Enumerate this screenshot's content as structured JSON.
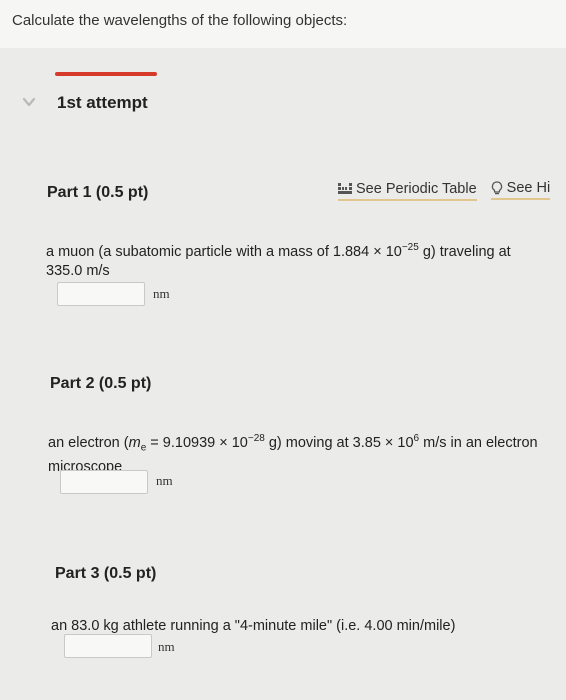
{
  "header": {
    "instruction": "Calculate the wavelengths of the following objects:"
  },
  "attempt": {
    "label": "1st attempt"
  },
  "tools": {
    "periodic_table": "See Periodic Table",
    "hint": "See Hi"
  },
  "parts": [
    {
      "title": "Part 1 (0.5 pt)",
      "q_a": "a muon (a subatomic particle with a mass of 1.884 × 10",
      "q_exp": "−25",
      "q_b": " g) traveling at",
      "q_line2": "335.0 m/s",
      "unit": "nm"
    },
    {
      "title": "Part 2 (0.5 pt)",
      "q_a": "an electron (",
      "q_m": "m",
      "q_msub": "e",
      "q_b": " = 9.10939 × 10",
      "q_exp": "−28",
      "q_c": " g) moving at 3.85 × 10",
      "q_exp2": "6",
      "q_d": " m/s in an electron",
      "q_line2": "microscope",
      "unit": "nm"
    },
    {
      "title": "Part 3 (0.5 pt)",
      "q_a": "an 83.0 kg athlete running a \"4-minute mile\" (i.e. 4.00 min/mile)",
      "unit": "nm"
    }
  ]
}
